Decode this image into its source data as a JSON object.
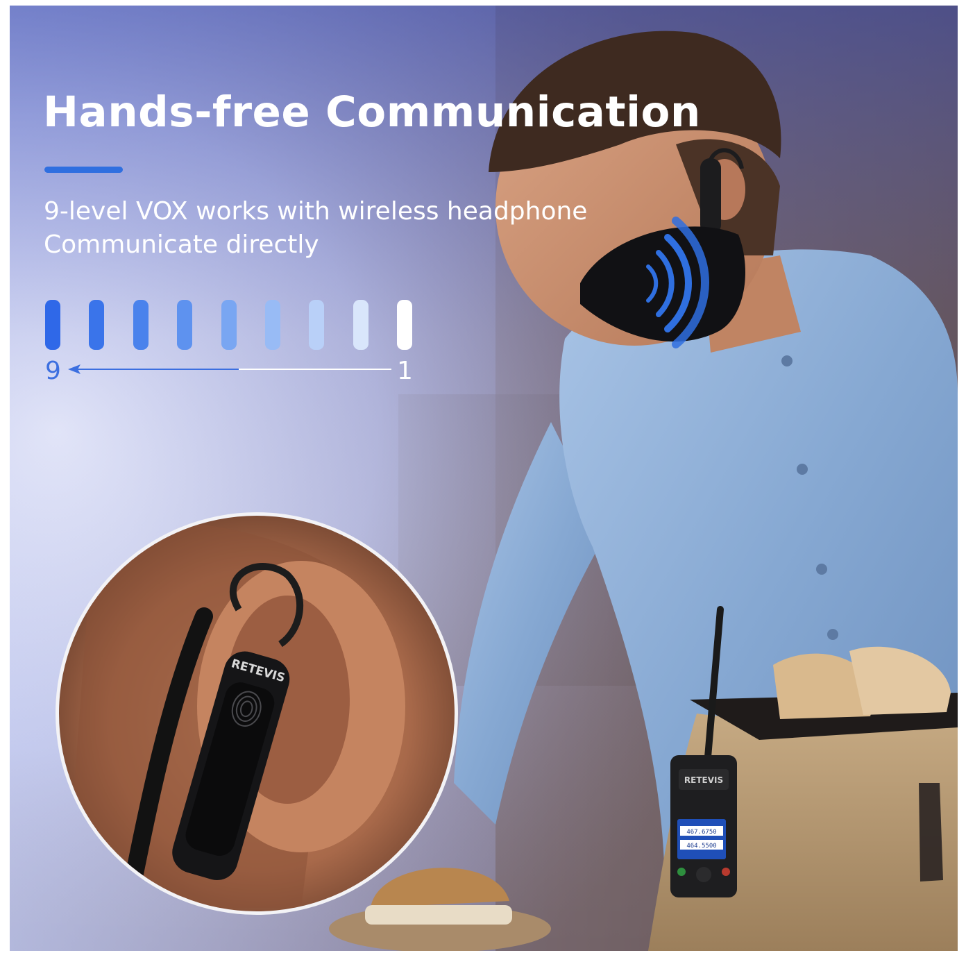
{
  "banner": {
    "title": "Hands-free Communication",
    "subtitle_line1": "9-level VOX works with wireless headphone",
    "subtitle_line2": "Communicate directly"
  },
  "vox_levels": {
    "count": 9,
    "max_label": "9",
    "min_label": "1",
    "bar_colors": [
      "#2f68e8",
      "#3a74ea",
      "#4a82ec",
      "#5e92ef",
      "#79a6f2",
      "#98bbf5",
      "#b9d0f8",
      "#d9e6fb",
      "#ffffff"
    ]
  },
  "photo": {
    "brand_marks": [
      "RETEVIS",
      "RETEVIS"
    ],
    "radio_display": [
      "467.6750",
      "464.5500"
    ],
    "colors": {
      "accent": "#2f6fe0",
      "shirt": "#8fb0d6",
      "apron": "#b79a73",
      "skin": "#b5785a"
    }
  }
}
